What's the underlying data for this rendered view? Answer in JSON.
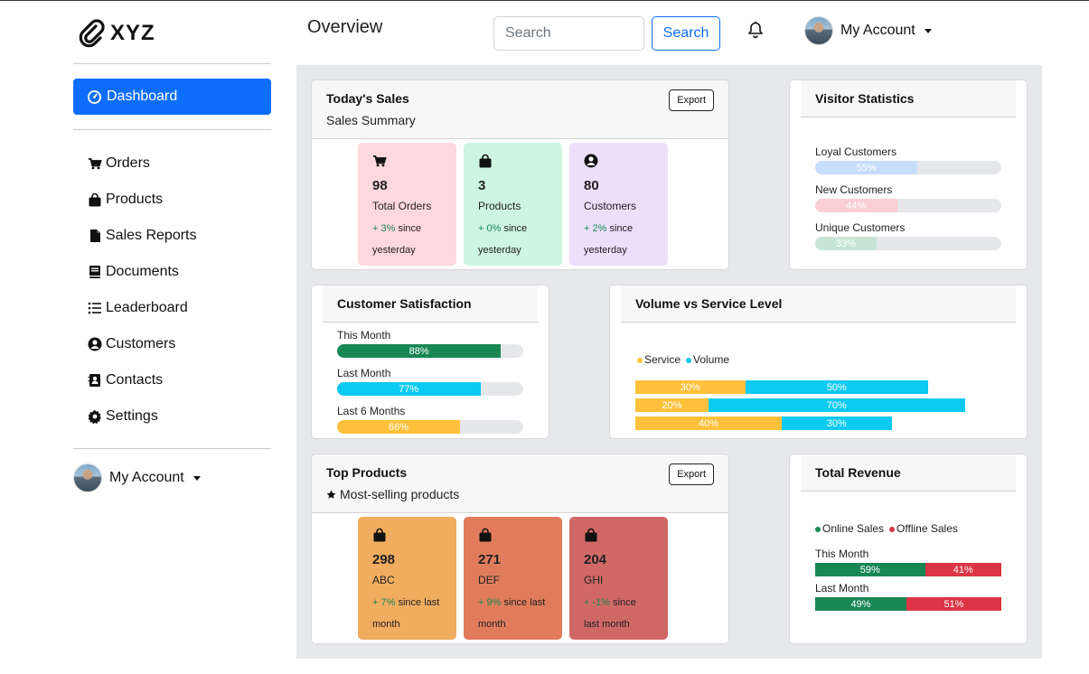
{
  "brand": {
    "name": "XYZ"
  },
  "sidebar": {
    "active": {
      "label": "Dashboard",
      "icon": "dashboard-icon"
    },
    "items": [
      {
        "label": "Orders",
        "icon": "cart-icon"
      },
      {
        "label": "Products",
        "icon": "bag-icon"
      },
      {
        "label": "Sales Reports",
        "icon": "file-icon"
      },
      {
        "label": "Documents",
        "icon": "book-icon"
      },
      {
        "label": "Leaderboard",
        "icon": "list-icon"
      },
      {
        "label": "Customers",
        "icon": "person-circle-icon"
      },
      {
        "label": "Contacts",
        "icon": "contact-card-icon"
      },
      {
        "label": "Settings",
        "icon": "gear-icon"
      }
    ],
    "account_label": "My Account"
  },
  "header": {
    "title": "Overview",
    "search_placeholder": "Search",
    "search_button": "Search",
    "account_label": "My Account"
  },
  "todays_sales": {
    "title": "Today's Sales",
    "subtitle": "Sales Summary",
    "export_label": "Export",
    "tiles": [
      {
        "icon": "cart-icon",
        "value": "98",
        "label": "Total Orders",
        "change": "+ 3%",
        "since": "since yesterday",
        "bg": "#ffd8de"
      },
      {
        "icon": "bag-icon",
        "value": "3",
        "label": "Products",
        "change": "+ 0%",
        "since": "since yesterday",
        "bg": "#cdf5e1"
      },
      {
        "icon": "person-circle-icon",
        "value": "80",
        "label": "Customers",
        "change": "+ 2%",
        "since": "since yesterday",
        "bg": "#ecdffb"
      }
    ]
  },
  "visitor_stats": {
    "title": "Visitor Statistics",
    "rows": [
      {
        "label": "Loyal Customers",
        "percent": 55,
        "text": "55%",
        "color": "#c7ddfb"
      },
      {
        "label": "New Customers",
        "percent": 44,
        "text": "44%",
        "color": "#f9cfd4"
      },
      {
        "label": "Unique Customers",
        "percent": 33,
        "text": "33%",
        "color": "#c7e5d6"
      }
    ]
  },
  "satisfaction": {
    "title": "Customer Satisfaction",
    "rows": [
      {
        "label": "This Month",
        "percent": 88,
        "text": "88%",
        "color": "#198754"
      },
      {
        "label": "Last Month",
        "percent": 77,
        "text": "77%",
        "color": "#0dcaf0"
      },
      {
        "label": "Last 6 Months",
        "percent": 66,
        "text": "66%",
        "color": "#ffc13b"
      }
    ]
  },
  "volume_service": {
    "title": "Volume vs Service Level",
    "legend": [
      {
        "label": "Service",
        "color": "#ffc13b"
      },
      {
        "label": "Volume",
        "color": "#0dcaf0"
      }
    ],
    "rows": [
      {
        "service": 30,
        "service_text": "30%",
        "volume": 50,
        "volume_text": "50%"
      },
      {
        "service": 20,
        "service_text": "20%",
        "volume": 70,
        "volume_text": "70%"
      },
      {
        "service": 40,
        "service_text": "40%",
        "volume": 30,
        "volume_text": "30%"
      }
    ]
  },
  "top_products": {
    "title": "Top Products",
    "subtitle": "Most-selling products",
    "export_label": "Export",
    "tiles": [
      {
        "icon": "bag-icon",
        "value": "298",
        "label": "ABC",
        "change": "+ 7%",
        "since": "since last month",
        "bg": "#f0ac5f"
      },
      {
        "icon": "bag-icon",
        "value": "271",
        "label": "DEF",
        "change": "+ 9%",
        "since": "since last month",
        "bg": "#e07c5c"
      },
      {
        "icon": "bag-icon",
        "value": "204",
        "label": "GHI",
        "change": "+ -1%",
        "since": "since last month",
        "bg": "#d06966"
      }
    ]
  },
  "total_revenue": {
    "title": "Total Revenue",
    "legend": [
      {
        "label": "Online Sales",
        "color": "#198754"
      },
      {
        "label": "Offline Sales",
        "color": "#dc3545"
      }
    ],
    "rows": [
      {
        "label": "This Month",
        "online": 59,
        "online_text": "59%",
        "offline": 41,
        "offline_text": "41%"
      },
      {
        "label": "Last Month",
        "online": 49,
        "online_text": "49%",
        "offline": 51,
        "offline_text": "51%"
      }
    ]
  }
}
